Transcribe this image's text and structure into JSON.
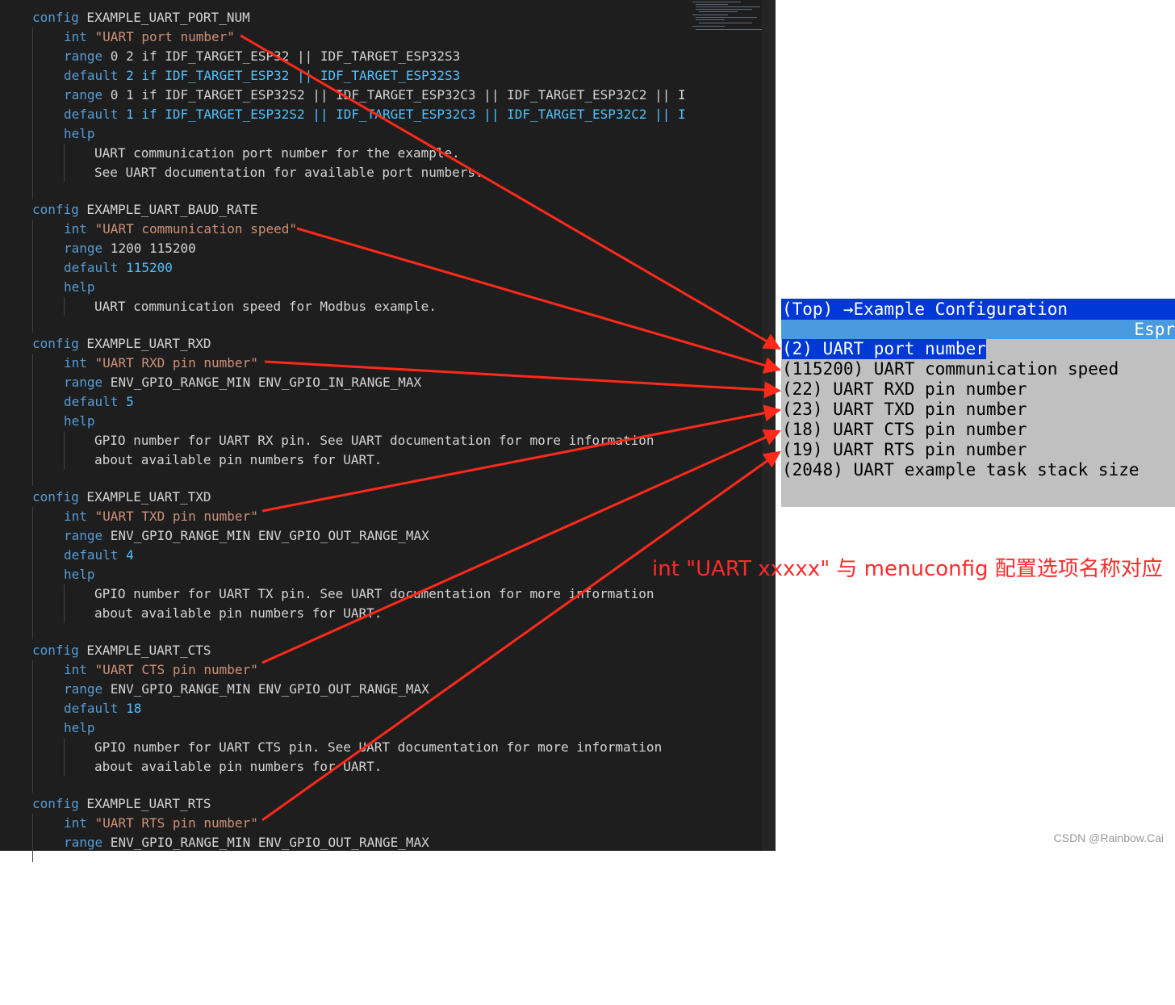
{
  "editor": {
    "lines": [
      {
        "t": "config",
        "a": " EXAMPLE_UART_PORT_NUM"
      },
      {
        "t": "int",
        "s": " \"UART port number\""
      },
      {
        "t": "range",
        "a": " 0 2 if IDF_TARGET_ESP32 || IDF_TARGET_ESP32S3"
      },
      {
        "t": "default",
        "n": " 2 if IDF_TARGET_ESP32 || IDF_TARGET_ESP32S3"
      },
      {
        "t": "range",
        "a": " 0 1 if IDF_TARGET_ESP32S2 || IDF_TARGET_ESP32C3 || IDF_TARGET_ESP32C2 || I"
      },
      {
        "t": "default",
        "n": " 1 if IDF_TARGET_ESP32S2 || IDF_TARGET_ESP32C3 || IDF_TARGET_ESP32C2 || I"
      },
      {
        "t": "help"
      },
      {
        "p": "UART communication port number for the example."
      },
      {
        "p": "See UART documentation for available port numbers."
      },
      {
        "t": "config",
        "a": " EXAMPLE_UART_BAUD_RATE"
      },
      {
        "t": "int",
        "s": " \"UART communication speed\""
      },
      {
        "t": "range",
        "a": " 1200 115200"
      },
      {
        "t": "default",
        "n": " 115200"
      },
      {
        "t": "help"
      },
      {
        "p": "UART communication speed for Modbus example."
      },
      {
        "t": "config",
        "a": " EXAMPLE_UART_RXD"
      },
      {
        "t": "int",
        "s": " \"UART RXD pin number\""
      },
      {
        "t": "range",
        "a": " ENV_GPIO_RANGE_MIN ENV_GPIO_IN_RANGE_MAX"
      },
      {
        "t": "default",
        "n": " 5"
      },
      {
        "t": "help"
      },
      {
        "p": "GPIO number for UART RX pin. See UART documentation for more information"
      },
      {
        "p": "about available pin numbers for UART."
      },
      {
        "t": "config",
        "a": " EXAMPLE_UART_TXD"
      },
      {
        "t": "int",
        "s": " \"UART TXD pin number\""
      },
      {
        "t": "range",
        "a": " ENV_GPIO_RANGE_MIN ENV_GPIO_OUT_RANGE_MAX"
      },
      {
        "t": "default",
        "n": " 4"
      },
      {
        "t": "help"
      },
      {
        "p": "GPIO number for UART TX pin. See UART documentation for more information"
      },
      {
        "p": "about available pin numbers for UART."
      },
      {
        "t": "config",
        "a": " EXAMPLE_UART_CTS"
      },
      {
        "t": "int",
        "s": " \"UART CTS pin number\""
      },
      {
        "t": "range",
        "a": " ENV_GPIO_RANGE_MIN ENV_GPIO_OUT_RANGE_MAX"
      },
      {
        "t": "default",
        "n": " 18"
      },
      {
        "t": "help"
      },
      {
        "p": "GPIO number for UART CTS pin. See UART documentation for more information"
      },
      {
        "p": "about available pin numbers for UART."
      },
      {
        "t": "config",
        "a": " EXAMPLE_UART_RTS"
      },
      {
        "t": "int",
        "s": " \"UART RTS pin number\""
      },
      {
        "t": "range",
        "a": " ENV_GPIO_RANGE_MIN ENV_GPIO_OUT_RANGE_MAX"
      }
    ]
  },
  "menuconfig": {
    "title": "(Top) →Example Configuration",
    "brand": "Espr",
    "items": [
      "(2) UART port number",
      "(115200) UART communication speed",
      "(22) UART RXD pin number",
      "(23) UART TXD pin number",
      "(18) UART CTS pin number",
      "(19) UART RTS pin number",
      "(2048) UART example task stack size"
    ],
    "selected_index": 0
  },
  "annotation": "int \"UART xxxxx\" 与 menuconfig 配置选项名称对应",
  "watermark": "CSDN @Rainbow.Cai",
  "colors": {
    "arrow": "#ff2a1a",
    "editor_bg": "#1e1e1e",
    "keyword": "#569cd6",
    "string": "#ce9178",
    "number": "#4fc1ff",
    "menu_title_bg": "#0038d8",
    "menu_bg": "#c0c0c0"
  }
}
